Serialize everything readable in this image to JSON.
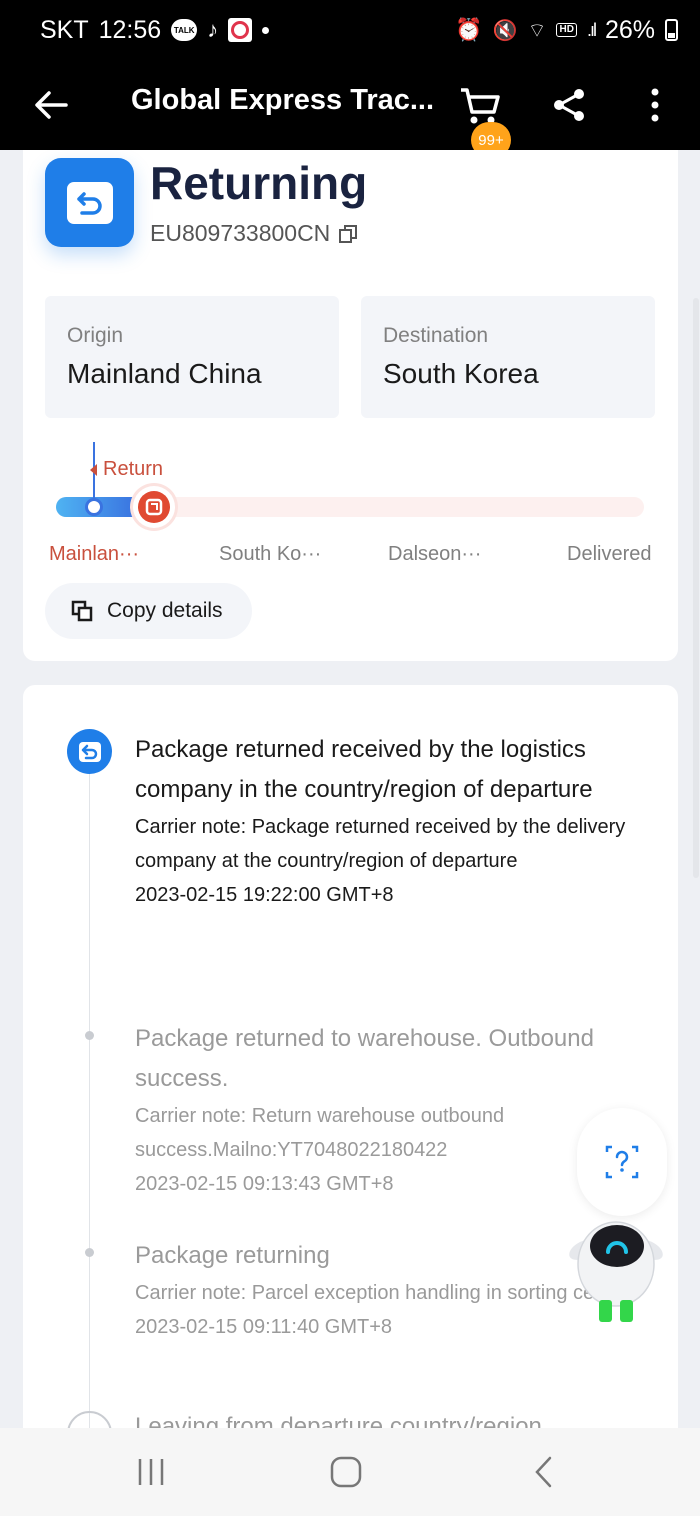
{
  "status_bar": {
    "carrier": "SKT",
    "time": "12:56",
    "talk_label": "TALK",
    "hd_label": "HD",
    "battery": "26%"
  },
  "app_bar": {
    "title": "Global Express Trac...",
    "cart_badge": "99+",
    "icons": [
      "back-arrow-icon",
      "cart-icon",
      "share-icon",
      "more-vertical-icon"
    ]
  },
  "summary": {
    "status": "Returning",
    "tracking_number": "EU809733800CN",
    "origin_label": "Origin",
    "origin_value": "Mainland China",
    "destination_label": "Destination",
    "destination_value": "South Korea",
    "return_label": "Return",
    "stages": [
      "Mainlan···",
      "South Ko···",
      "Dalseon···",
      "Delivered"
    ],
    "copy_details_label": "Copy details"
  },
  "timeline": {
    "events": [
      {
        "title": "Package returned received by the logistics company in the country/region of departure",
        "note": "Carrier note: Package returned received by the delivery company at the country/region of departure",
        "time": "2023-02-15 19:22:00 GMT+8"
      },
      {
        "title": "Package returned to warehouse. Outbound success.",
        "note": "Carrier note: Return warehouse outbound success.Mailno:YT7048022180422",
        "time": "2023-02-15 09:13:43 GMT+8"
      },
      {
        "title": "Package returning",
        "note": "Carrier note: Parcel exception handling in sorting center.",
        "time": "2023-02-15 09:11:40 GMT+8"
      }
    ],
    "next_partial": "Leaving from departure country/region"
  },
  "colors": {
    "accent_blue": "#1f7ee8",
    "return_red": "#c9503d",
    "badge_orange": "#ffa31a"
  }
}
